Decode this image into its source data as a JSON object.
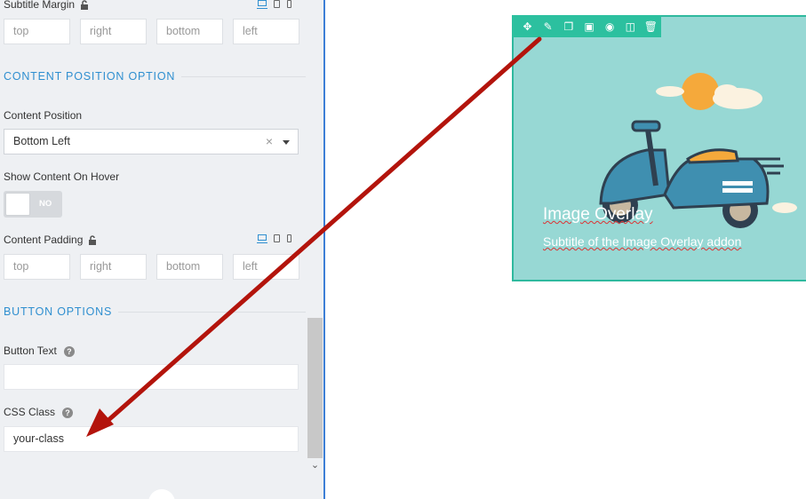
{
  "sidebar": {
    "subtitle_margin": {
      "label": "Subtitle Margin",
      "top": "top",
      "right": "right",
      "bottom": "bottom",
      "left": "left"
    },
    "content_position_section": "CONTENT POSITION OPTION",
    "content_position": {
      "label": "Content Position",
      "value": "Bottom Left",
      "clear": "×"
    },
    "show_content_on_hover": {
      "label": "Show Content On Hover",
      "toggle": "NO"
    },
    "content_padding": {
      "label": "Content Padding",
      "top": "top",
      "right": "right",
      "bottom": "bottom",
      "left": "left"
    },
    "button_section": "BUTTON OPTIONS",
    "button_text": {
      "label": "Button Text",
      "help": "?",
      "value": ""
    },
    "css_class": {
      "label": "CSS Class",
      "help": "?",
      "value": "your-class"
    }
  },
  "preview": {
    "toolbar_icons": [
      "move-icon",
      "edit-icon",
      "duplicate-icon",
      "save-icon",
      "view-icon",
      "columns-icon",
      "delete-icon"
    ],
    "title": "Image Overlay",
    "subtitle": "Subtitle of the Image Overlay addon"
  },
  "colors": {
    "accent": "#2f8fd0",
    "toolbar": "#2cc09f",
    "preview_bg": "#97d8d4",
    "arrow": "#b3140c"
  }
}
